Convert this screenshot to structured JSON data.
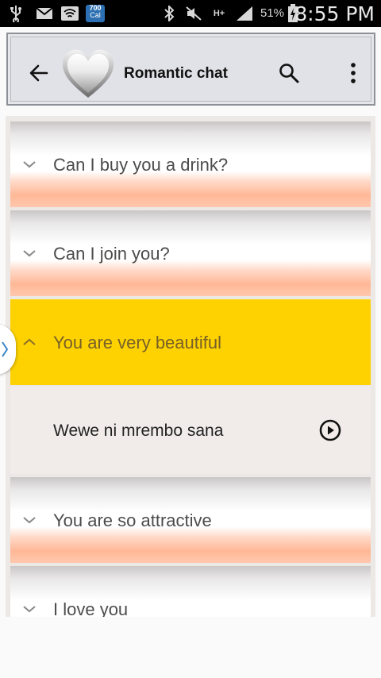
{
  "status_bar": {
    "badge_top": "700",
    "badge_bottom": "Cal",
    "network": "H+",
    "battery_percent": "51%",
    "time": "8:55 PM"
  },
  "app_bar": {
    "title": "Romantic chat",
    "icons": [
      "back-arrow-icon",
      "heart-logo-icon",
      "search-icon",
      "more-vert-icon"
    ]
  },
  "phrases": [
    {
      "english": "Can I buy you a drink?",
      "expanded": false
    },
    {
      "english": "Can I join you?",
      "expanded": false
    },
    {
      "english": "You are very beautiful",
      "expanded": true,
      "translation": "Wewe ni mrembo sana"
    },
    {
      "english": "You are so attractive",
      "expanded": false
    },
    {
      "english": "I love you",
      "expanded": false
    }
  ],
  "colors": {
    "expanded_row": "#fdd200",
    "peach_gradient": "#ffb896",
    "text": "#4c4c4c"
  }
}
